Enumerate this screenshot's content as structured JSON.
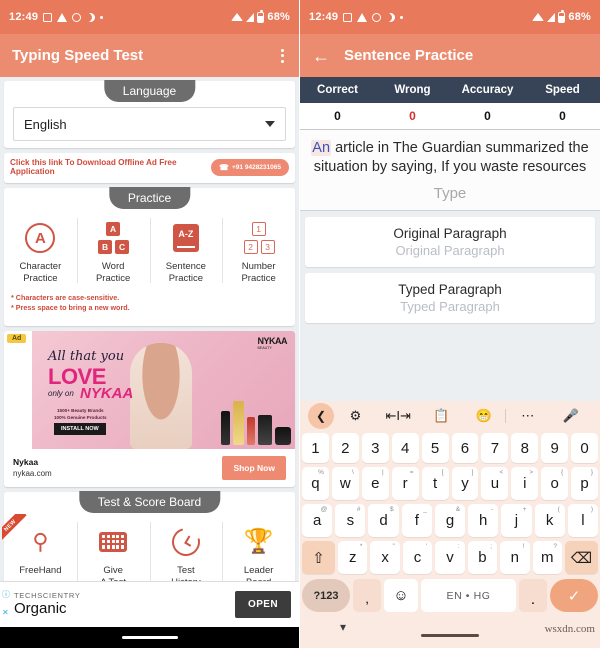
{
  "status_bar": {
    "time": "12:49",
    "battery": "68%",
    "icons": [
      "screenshot-icon",
      "drive-icon",
      "whatsapp-icon",
      "moon-icon",
      "dot-icon",
      "wifi-icon",
      "signal-icon",
      "battery-icon"
    ]
  },
  "left": {
    "appbar": {
      "title": "Typing Speed Test",
      "menu": "overflow-menu"
    },
    "language": {
      "pill": "Language",
      "selected": "English",
      "link_text": "Click this link To Download Offline Ad Free Application",
      "phone": "+91 9428231065"
    },
    "practice": {
      "pill": "Practice",
      "items": [
        {
          "label_line1": "Character",
          "label_line2": "Practice",
          "icon": "letter-a-circle-icon",
          "glyph": "A"
        },
        {
          "label_line1": "Word",
          "label_line2": "Practice",
          "icon": "abc-blocks-icon",
          "blocks": [
            "A",
            "B",
            "C"
          ]
        },
        {
          "label_line1": "Sentence",
          "label_line2": "Practice",
          "icon": "az-book-icon",
          "glyph": "A-Z"
        },
        {
          "label_line1": "Number",
          "label_line2": "Practice",
          "icon": "number-blocks-icon",
          "blocks": [
            "1",
            "2",
            "3"
          ]
        }
      ],
      "notes": [
        "* Characters are case-sensitive.",
        "* Press space to bring a new word."
      ]
    },
    "ad": {
      "badge": "Ad",
      "headline1": "All that you",
      "headline2": "LOVE",
      "headline3": "only on",
      "brand_script": "NYKAA",
      "brand_logo": "NYKAA",
      "brand_logo_sub": "BEAUTY",
      "sub1": "1500+ Beauty Brands",
      "sub2": "100% Genuine Products",
      "cta": "INSTALL NOW",
      "advertiser": "Nykaa",
      "url": "nykaa.com",
      "button": "Shop Now"
    },
    "score_board": {
      "pill": "Test & Score Board",
      "items": [
        {
          "label_line1": "FreeHand",
          "label_line2": "",
          "icon": "freehand-icon",
          "ribbon": "NEW"
        },
        {
          "label_line1": "Give",
          "label_line2": "A Test",
          "icon": "keyboard-icon",
          "ribbon": ""
        },
        {
          "label_line1": "Test",
          "label_line2": "History",
          "icon": "history-clock-icon",
          "ribbon": ""
        },
        {
          "label_line1": "Leader",
          "label_line2": "Board",
          "icon": "trophy-icon",
          "ribbon": ""
        }
      ]
    },
    "bottom_ad": {
      "kicker": "TECHSCIENTRY",
      "title": "Organic",
      "button": "OPEN",
      "info_icon": "info-icon",
      "close_icon": "close-icon"
    }
  },
  "right": {
    "appbar": {
      "title": "Sentence Practice",
      "back": "back-arrow-icon"
    },
    "stats": {
      "headers": [
        "Correct",
        "Wrong",
        "Accuracy",
        "Speed"
      ],
      "values": [
        "0",
        "0",
        "0",
        "0"
      ]
    },
    "sentence": {
      "current_word": "An",
      "rest": " article in The Guardian summarized the situation by saying, If you waste resources",
      "input_placeholder": "Type"
    },
    "paragraphs": [
      {
        "title": "Original Paragraph",
        "placeholder": "Original Paragraph"
      },
      {
        "title": "Typed Paragraph",
        "placeholder": "Typed Paragraph"
      }
    ],
    "keyboard": {
      "toolbar": [
        "back-chevron-icon",
        "gear-icon",
        "cursor-move-icon",
        "clipboard-icon",
        "sticker-icon",
        "more-icon",
        "mic-icon"
      ],
      "row_numbers": [
        "1",
        "2",
        "3",
        "4",
        "5",
        "6",
        "7",
        "8",
        "9",
        "0"
      ],
      "row1": [
        {
          "k": "q",
          "s": "%"
        },
        {
          "k": "w",
          "s": "\\"
        },
        {
          "k": "e",
          "s": "|"
        },
        {
          "k": "r",
          "s": "="
        },
        {
          "k": "t",
          "s": "["
        },
        {
          "k": "y",
          "s": "]"
        },
        {
          "k": "u",
          "s": "<"
        },
        {
          "k": "i",
          "s": ">"
        },
        {
          "k": "o",
          "s": "{"
        },
        {
          "k": "p",
          "s": "}"
        }
      ],
      "row2": [
        {
          "k": "a",
          "s": "@"
        },
        {
          "k": "s",
          "s": "#"
        },
        {
          "k": "d",
          "s": "$"
        },
        {
          "k": "f",
          "s": "_"
        },
        {
          "k": "g",
          "s": "&"
        },
        {
          "k": "h",
          "s": "-"
        },
        {
          "k": "j",
          "s": "+"
        },
        {
          "k": "k",
          "s": "("
        },
        {
          "k": "l",
          "s": ")"
        }
      ],
      "row3": [
        {
          "k": "z",
          "s": "*"
        },
        {
          "k": "x",
          "s": "\""
        },
        {
          "k": "c",
          "s": "'"
        },
        {
          "k": "v",
          "s": ":"
        },
        {
          "k": "b",
          "s": ";"
        },
        {
          "k": "n",
          "s": "!"
        },
        {
          "k": "m",
          "s": "?"
        }
      ],
      "shift_icon": "shift-icon",
      "backspace_icon": "backspace-icon",
      "symbols_key": "?123",
      "comma_key": ",",
      "emoji_icon": "emoji-icon",
      "space_label": "EN • HG",
      "period_key": ".",
      "enter_icon": "check-icon",
      "collapse_icon": "chevron-down-icon"
    },
    "watermark": "wsxdn.com"
  }
}
